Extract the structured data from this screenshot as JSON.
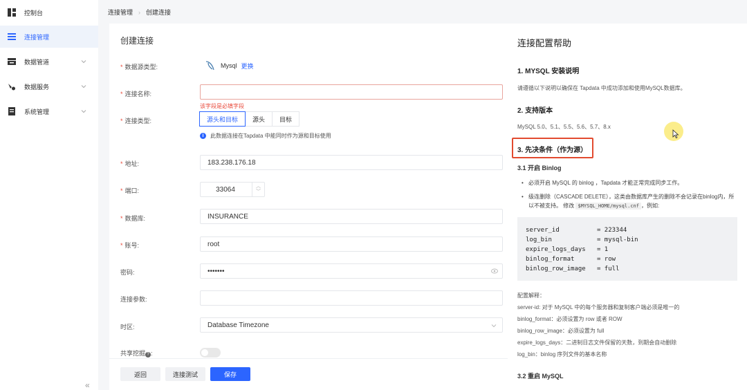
{
  "sidebar": {
    "items": [
      {
        "label": "控制台",
        "icon": "dashboard-icon",
        "active": false
      },
      {
        "label": "连接管理",
        "icon": "connection-icon",
        "active": true
      },
      {
        "label": "数据管道",
        "icon": "pipeline-icon",
        "active": false
      },
      {
        "label": "数据服务",
        "icon": "service-icon",
        "active": false
      },
      {
        "label": "系统管理",
        "icon": "system-icon",
        "active": false
      }
    ],
    "collapse": "«"
  },
  "breadcrumb": {
    "parent": "连接管理",
    "current": "创建连接"
  },
  "form": {
    "title": "创建连接",
    "source_type_label": "数据源类型:",
    "source_type_value": "Mysql",
    "change_label": "更换",
    "name_label": "连接名称:",
    "name_value": "",
    "name_error": "该字段是必填字段",
    "conn_type_label": "连接类型:",
    "conn_type_options": [
      "源头和目标",
      "源头",
      "目标"
    ],
    "conn_type_selected": "源头和目标",
    "conn_type_hint": "此数据连接在Tapdata 中能同时作为源和目标使用",
    "host_label": "地址:",
    "host_value": "183.238.176.18",
    "port_label": "端口:",
    "port_value": "33064",
    "db_label": "数据库:",
    "db_value": "INSURANCE",
    "user_label": "账号:",
    "user_value": "root",
    "pwd_label": "密码:",
    "pwd_value": "•••••••",
    "params_label": "连接参数:",
    "params_value": "",
    "tz_label": "时区:",
    "tz_value": "Database Timezone",
    "share_label": "共享挖掘",
    "share_colon": ":"
  },
  "footer": {
    "back": "返回",
    "test": "连接测试",
    "save": "保存"
  },
  "help": {
    "title": "连接配置帮助",
    "s1": "1. MYSQL 安装说明",
    "s1_text": "请遵循以下说明以确保在 Tapdata 中成功添加和使用MySQL数据库。",
    "s2": "2. 支持版本",
    "s2_text": "MySQL 5.0、5.1、5.5、5.6、5.7、8.x",
    "s3": "3. 先决条件（作为源）",
    "s31": "3.1 开启 Binlog",
    "b1": "必须开启 MySQL 的 binlog ，Tapdata 才能正常完成同步工作。",
    "b2a": "级连删除（CASCADE DELETE），这类由数据库产生的删除不会记录在binlog内，所以不被支持。 修改",
    "b2code": "$MYSQL_HOME/mysql.cnf",
    "b2b": "，例如:",
    "code_lines": [
      "server_id          = 223344",
      "log_bin            = mysql-bin",
      "expire_logs_days   = 1",
      "binlog_format      = row",
      "binlog_row_image   = full"
    ],
    "notes_title": "配置解释：",
    "notes": [
      "server-id: 对于 MySQL 中的每个服务器和复制客户端必须是唯一的",
      "binlog_format：必须设置为 row 或者 ROW",
      "binlog_row_image：必须设置为 full",
      "expire_logs_days：二进制日志文件保留的天数，到期会自动删除",
      "log_bin：binlog 序列文件的基本名称"
    ],
    "s32": "3.2 重启 MySQL"
  },
  "colors": {
    "accent": "#2c65ff",
    "error": "#e94b3c",
    "highlight": "#e24a2f"
  }
}
